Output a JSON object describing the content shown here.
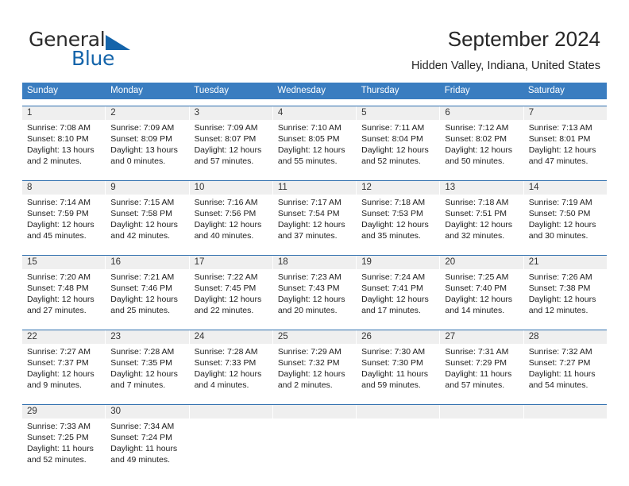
{
  "brand": {
    "name_top": "General",
    "name_bottom": "Blue",
    "flag_icon": "blue-triangle-flag-icon",
    "accent_color": "#1464aa"
  },
  "header": {
    "title": "September 2024",
    "subtitle": "Hidden Valley, Indiana, United States"
  },
  "calendar": {
    "header_bg": "#3a7dc0",
    "daynum_bg": "#efefef",
    "weekday_headers": [
      "Sunday",
      "Monday",
      "Tuesday",
      "Wednesday",
      "Thursday",
      "Friday",
      "Saturday"
    ],
    "weeks": [
      {
        "days": [
          {
            "num": "1",
            "sunrise": "Sunrise: 7:08 AM",
            "sunset": "Sunset: 8:10 PM",
            "daylight_line1": "Daylight: 13 hours",
            "daylight_line2": "and 2 minutes."
          },
          {
            "num": "2",
            "sunrise": "Sunrise: 7:09 AM",
            "sunset": "Sunset: 8:09 PM",
            "daylight_line1": "Daylight: 13 hours",
            "daylight_line2": "and 0 minutes."
          },
          {
            "num": "3",
            "sunrise": "Sunrise: 7:09 AM",
            "sunset": "Sunset: 8:07 PM",
            "daylight_line1": "Daylight: 12 hours",
            "daylight_line2": "and 57 minutes."
          },
          {
            "num": "4",
            "sunrise": "Sunrise: 7:10 AM",
            "sunset": "Sunset: 8:05 PM",
            "daylight_line1": "Daylight: 12 hours",
            "daylight_line2": "and 55 minutes."
          },
          {
            "num": "5",
            "sunrise": "Sunrise: 7:11 AM",
            "sunset": "Sunset: 8:04 PM",
            "daylight_line1": "Daylight: 12 hours",
            "daylight_line2": "and 52 minutes."
          },
          {
            "num": "6",
            "sunrise": "Sunrise: 7:12 AM",
            "sunset": "Sunset: 8:02 PM",
            "daylight_line1": "Daylight: 12 hours",
            "daylight_line2": "and 50 minutes."
          },
          {
            "num": "7",
            "sunrise": "Sunrise: 7:13 AM",
            "sunset": "Sunset: 8:01 PM",
            "daylight_line1": "Daylight: 12 hours",
            "daylight_line2": "and 47 minutes."
          }
        ]
      },
      {
        "days": [
          {
            "num": "8",
            "sunrise": "Sunrise: 7:14 AM",
            "sunset": "Sunset: 7:59 PM",
            "daylight_line1": "Daylight: 12 hours",
            "daylight_line2": "and 45 minutes."
          },
          {
            "num": "9",
            "sunrise": "Sunrise: 7:15 AM",
            "sunset": "Sunset: 7:58 PM",
            "daylight_line1": "Daylight: 12 hours",
            "daylight_line2": "and 42 minutes."
          },
          {
            "num": "10",
            "sunrise": "Sunrise: 7:16 AM",
            "sunset": "Sunset: 7:56 PM",
            "daylight_line1": "Daylight: 12 hours",
            "daylight_line2": "and 40 minutes."
          },
          {
            "num": "11",
            "sunrise": "Sunrise: 7:17 AM",
            "sunset": "Sunset: 7:54 PM",
            "daylight_line1": "Daylight: 12 hours",
            "daylight_line2": "and 37 minutes."
          },
          {
            "num": "12",
            "sunrise": "Sunrise: 7:18 AM",
            "sunset": "Sunset: 7:53 PM",
            "daylight_line1": "Daylight: 12 hours",
            "daylight_line2": "and 35 minutes."
          },
          {
            "num": "13",
            "sunrise": "Sunrise: 7:18 AM",
            "sunset": "Sunset: 7:51 PM",
            "daylight_line1": "Daylight: 12 hours",
            "daylight_line2": "and 32 minutes."
          },
          {
            "num": "14",
            "sunrise": "Sunrise: 7:19 AM",
            "sunset": "Sunset: 7:50 PM",
            "daylight_line1": "Daylight: 12 hours",
            "daylight_line2": "and 30 minutes."
          }
        ]
      },
      {
        "days": [
          {
            "num": "15",
            "sunrise": "Sunrise: 7:20 AM",
            "sunset": "Sunset: 7:48 PM",
            "daylight_line1": "Daylight: 12 hours",
            "daylight_line2": "and 27 minutes."
          },
          {
            "num": "16",
            "sunrise": "Sunrise: 7:21 AM",
            "sunset": "Sunset: 7:46 PM",
            "daylight_line1": "Daylight: 12 hours",
            "daylight_line2": "and 25 minutes."
          },
          {
            "num": "17",
            "sunrise": "Sunrise: 7:22 AM",
            "sunset": "Sunset: 7:45 PM",
            "daylight_line1": "Daylight: 12 hours",
            "daylight_line2": "and 22 minutes."
          },
          {
            "num": "18",
            "sunrise": "Sunrise: 7:23 AM",
            "sunset": "Sunset: 7:43 PM",
            "daylight_line1": "Daylight: 12 hours",
            "daylight_line2": "and 20 minutes."
          },
          {
            "num": "19",
            "sunrise": "Sunrise: 7:24 AM",
            "sunset": "Sunset: 7:41 PM",
            "daylight_line1": "Daylight: 12 hours",
            "daylight_line2": "and 17 minutes."
          },
          {
            "num": "20",
            "sunrise": "Sunrise: 7:25 AM",
            "sunset": "Sunset: 7:40 PM",
            "daylight_line1": "Daylight: 12 hours",
            "daylight_line2": "and 14 minutes."
          },
          {
            "num": "21",
            "sunrise": "Sunrise: 7:26 AM",
            "sunset": "Sunset: 7:38 PM",
            "daylight_line1": "Daylight: 12 hours",
            "daylight_line2": "and 12 minutes."
          }
        ]
      },
      {
        "days": [
          {
            "num": "22",
            "sunrise": "Sunrise: 7:27 AM",
            "sunset": "Sunset: 7:37 PM",
            "daylight_line1": "Daylight: 12 hours",
            "daylight_line2": "and 9 minutes."
          },
          {
            "num": "23",
            "sunrise": "Sunrise: 7:28 AM",
            "sunset": "Sunset: 7:35 PM",
            "daylight_line1": "Daylight: 12 hours",
            "daylight_line2": "and 7 minutes."
          },
          {
            "num": "24",
            "sunrise": "Sunrise: 7:28 AM",
            "sunset": "Sunset: 7:33 PM",
            "daylight_line1": "Daylight: 12 hours",
            "daylight_line2": "and 4 minutes."
          },
          {
            "num": "25",
            "sunrise": "Sunrise: 7:29 AM",
            "sunset": "Sunset: 7:32 PM",
            "daylight_line1": "Daylight: 12 hours",
            "daylight_line2": "and 2 minutes."
          },
          {
            "num": "26",
            "sunrise": "Sunrise: 7:30 AM",
            "sunset": "Sunset: 7:30 PM",
            "daylight_line1": "Daylight: 11 hours",
            "daylight_line2": "and 59 minutes."
          },
          {
            "num": "27",
            "sunrise": "Sunrise: 7:31 AM",
            "sunset": "Sunset: 7:29 PM",
            "daylight_line1": "Daylight: 11 hours",
            "daylight_line2": "and 57 minutes."
          },
          {
            "num": "28",
            "sunrise": "Sunrise: 7:32 AM",
            "sunset": "Sunset: 7:27 PM",
            "daylight_line1": "Daylight: 11 hours",
            "daylight_line2": "and 54 minutes."
          }
        ]
      },
      {
        "days": [
          {
            "num": "29",
            "sunrise": "Sunrise: 7:33 AM",
            "sunset": "Sunset: 7:25 PM",
            "daylight_line1": "Daylight: 11 hours",
            "daylight_line2": "and 52 minutes."
          },
          {
            "num": "30",
            "sunrise": "Sunrise: 7:34 AM",
            "sunset": "Sunset: 7:24 PM",
            "daylight_line1": "Daylight: 11 hours",
            "daylight_line2": "and 49 minutes."
          },
          {
            "num": "",
            "sunrise": "",
            "sunset": "",
            "daylight_line1": "",
            "daylight_line2": ""
          },
          {
            "num": "",
            "sunrise": "",
            "sunset": "",
            "daylight_line1": "",
            "daylight_line2": ""
          },
          {
            "num": "",
            "sunrise": "",
            "sunset": "",
            "daylight_line1": "",
            "daylight_line2": ""
          },
          {
            "num": "",
            "sunrise": "",
            "sunset": "",
            "daylight_line1": "",
            "daylight_line2": ""
          },
          {
            "num": "",
            "sunrise": "",
            "sunset": "",
            "daylight_line1": "",
            "daylight_line2": ""
          }
        ]
      }
    ]
  }
}
